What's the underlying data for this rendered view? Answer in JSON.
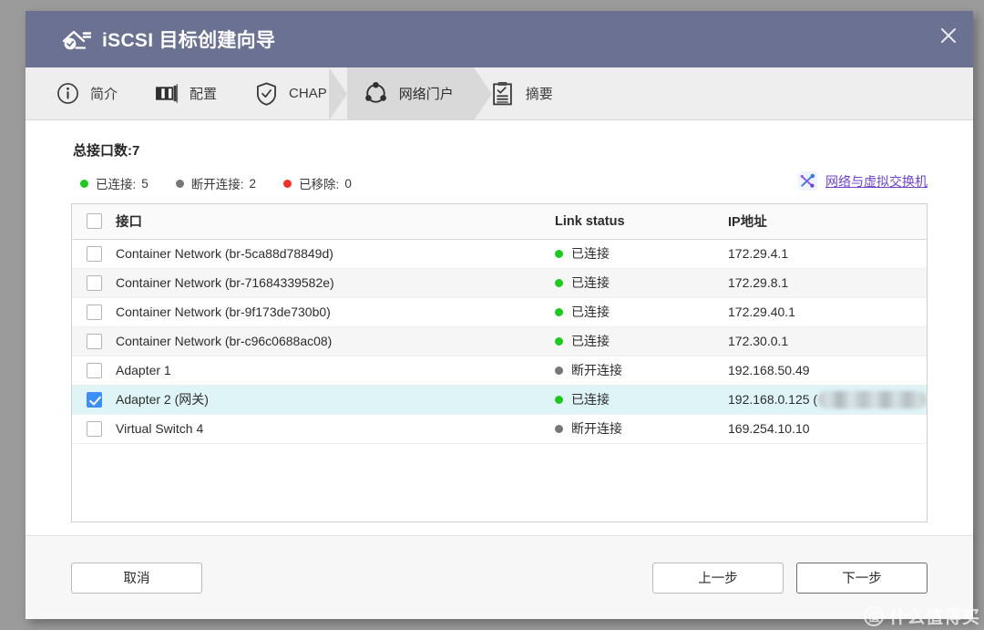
{
  "window": {
    "title": "iSCSI 目标创建向导",
    "title_icon": "iscsi-target-icon",
    "close_icon": "close-icon"
  },
  "steps": [
    {
      "label": "简介",
      "icon": "info-circle-icon",
      "active": false
    },
    {
      "label": "配置",
      "icon": "server-icon",
      "active": false
    },
    {
      "label": "CHAP",
      "icon": "shield-check-icon",
      "active": false
    },
    {
      "label": "网络门户",
      "icon": "network-ring-icon",
      "active": true
    },
    {
      "label": "摘要",
      "icon": "clipboard-check-icon",
      "active": false
    }
  ],
  "main": {
    "total_label": "总接口数:7",
    "legend": [
      {
        "label": "已连接:",
        "value": "5",
        "color": "#1ec81e"
      },
      {
        "label": "断开连接:",
        "value": "2",
        "color": "#777777"
      },
      {
        "label": "已移除:",
        "value": "0",
        "color": "#f0322c"
      }
    ],
    "switch_link": {
      "text": "网络与虚拟交换机",
      "icon": "network-switch-icon",
      "color": "#6d44c8"
    },
    "table": {
      "headers": [
        "接口",
        "Link status",
        "IP地址"
      ],
      "header_checkbox_checked": false,
      "rows": [
        {
          "checked": false,
          "name": "Container Network (br-5ca88d78849d)",
          "status": "已连接",
          "status_color": "#1ec81e",
          "ip": "172.29.4.1",
          "redacted": false
        },
        {
          "checked": false,
          "name": "Container Network (br-71684339582e)",
          "status": "已连接",
          "status_color": "#1ec81e",
          "ip": "172.29.8.1",
          "redacted": false
        },
        {
          "checked": false,
          "name": "Container Network (br-9f173de730b0)",
          "status": "已连接",
          "status_color": "#1ec81e",
          "ip": "172.29.40.1",
          "redacted": false
        },
        {
          "checked": false,
          "name": "Container Network (br-c96c0688ac08)",
          "status": "已连接",
          "status_color": "#1ec81e",
          "ip": "172.30.0.1",
          "redacted": false
        },
        {
          "checked": false,
          "name": "Adapter 1",
          "status": "断开连接",
          "status_color": "#777777",
          "ip": "192.168.50.49",
          "redacted": false
        },
        {
          "checked": true,
          "name": "Adapter 2 (网关)",
          "status": "已连接",
          "status_color": "#1ec81e",
          "ip": "192.168.0.125 (",
          "redacted": true
        },
        {
          "checked": false,
          "name": "Virtual Switch 4",
          "status": "断开连接",
          "status_color": "#777777",
          "ip": "169.254.10.10",
          "redacted": false
        }
      ]
    }
  },
  "footer": {
    "cancel": "取消",
    "previous": "上一步",
    "next": "下一步"
  },
  "watermark": {
    "logo": "值",
    "text": "什么值得买"
  }
}
